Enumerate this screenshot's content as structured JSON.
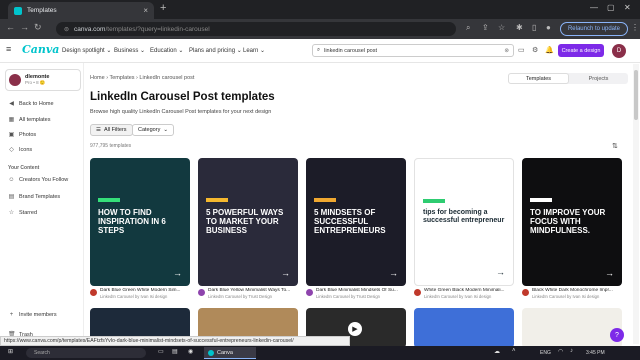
{
  "browser": {
    "tab_title": "Templates",
    "url_host": "canva.com",
    "url_rest": "/templates/?query=linkedin-carousel",
    "relaunch": "Relaunch to update"
  },
  "header": {
    "logo": "Canva",
    "menus": [
      "Design spotlight ⌄",
      "Business ⌄",
      "Education ⌄",
      "Plans and pricing ⌄",
      "Learn ⌄"
    ],
    "search_value": "linkedin carousel post",
    "create": "Create a design",
    "avatar_initial": "D"
  },
  "sidebar": {
    "account_name": "dlemonte",
    "account_plan": "Pro • 8 🙂",
    "items": [
      {
        "icon": "◀",
        "label": "Back to Home"
      },
      {
        "icon": "▦",
        "label": "All templates"
      },
      {
        "icon": "▣",
        "label": "Photos"
      },
      {
        "icon": "◇",
        "label": "Icons"
      }
    ],
    "section": "Your Content",
    "content_items": [
      {
        "icon": "☺",
        "label": "Creators You Follow"
      },
      {
        "icon": "▤",
        "label": "Brand Templates"
      },
      {
        "icon": "☆",
        "label": "Starred"
      }
    ],
    "bottom_items": [
      {
        "icon": "+",
        "label": "Invite members"
      },
      {
        "icon": "🗑",
        "label": "Trash"
      }
    ]
  },
  "main": {
    "breadcrumb": "Home  ›  Templates  ›  LinkedIn carousel post",
    "tabs": [
      "Templates",
      "Projects"
    ],
    "title": "LinkedIn Carousel Post templates",
    "subtitle": "Browse high quality LinkedIn Carousel Post templates for your next design",
    "filter_all": "All Filters",
    "filter_category": "Category",
    "count": "977,795 templates",
    "cards": [
      {
        "bg": "#12393f",
        "accent": "#35e07a",
        "text": "HOW TO FIND INSPIRATION IN 6 STEPS",
        "title": "Dark Blue Green White Modern Sim...",
        "author": "LinkedIn Carousel by Ivan Isi design",
        "ac": "#c0392b"
      },
      {
        "bg": "#2a2a3a",
        "accent": "#f5b82e",
        "text": "5 POWERFUL WAYS TO MARKET YOUR BUSINESS",
        "title": "Dark Blue Yellow Minimalist Ways To...",
        "author": "LinkedIn Carousel by Trust Design",
        "ac": "#8e44ad"
      },
      {
        "bg": "#1c1c28",
        "accent": "#f0a830",
        "text": "5 MINDSETS OF SUCCESSFUL ENTREPRENEURS",
        "title": "Dark Blue Minimalist Mindsets Of Su...",
        "author": "LinkedIn Carousel by Trust Design",
        "ac": "#8e44ad"
      },
      {
        "bg": "#ffffff",
        "accent": "#2ecc71",
        "text": "tips for becoming a successful entrepreneur",
        "title": "White Green Black Modern Minimali...",
        "author": "LinkedIn Carousel by Ivan Isi design",
        "ac": "#c0392b"
      },
      {
        "bg": "#0e0e10",
        "accent": "#ffffff",
        "text": "TO IMPROVE YOUR FOCUS WITH MINDFULNESS.",
        "title": "Black White Dark Monochrome Impr...",
        "author": "LinkedIn Carousel by Ivan Isi design",
        "ac": "#c0392b"
      }
    ],
    "status_url": "https://www.canva.com/p/templates/EAFtzfsYvIo-dark-blue-minimalist-mindsets-of-successful-entrepreneurs-linkedin-carousel/"
  },
  "taskbar": {
    "search": "Search",
    "app": "Canva",
    "tray": "ENG",
    "clock": "3:45 PM"
  }
}
